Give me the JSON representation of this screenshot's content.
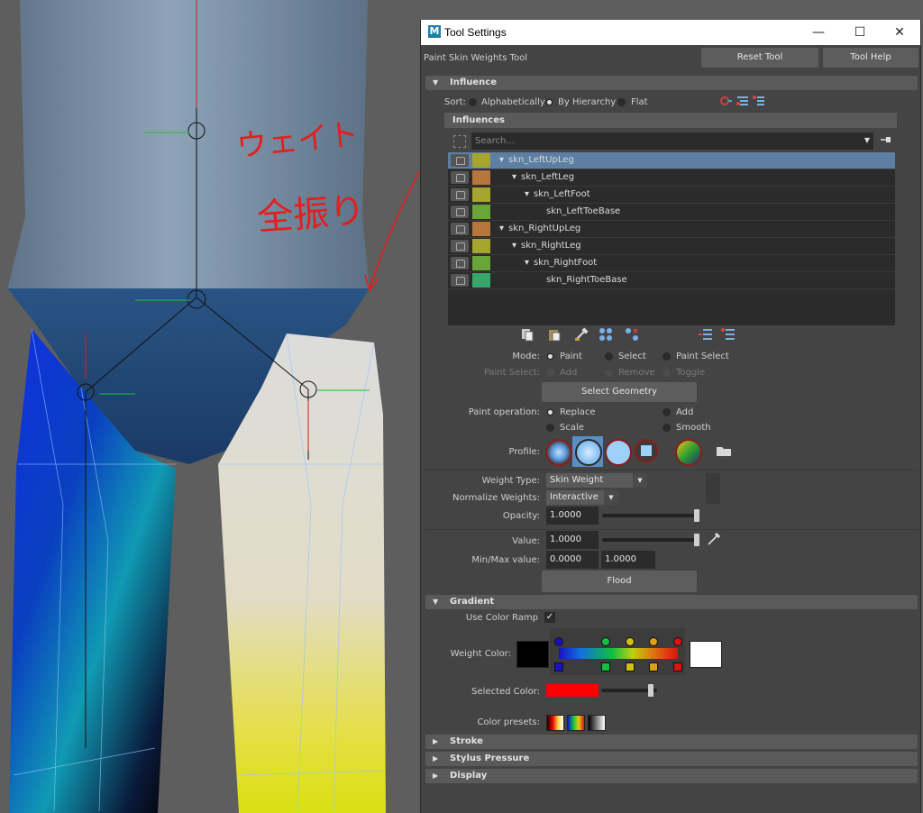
{
  "window": {
    "title": "Tool Settings",
    "logo_letter": "M",
    "minimize": "—",
    "maximize": "☐",
    "close": "✕"
  },
  "header": {
    "tool_name": "Paint Skin Weights Tool",
    "reset_label": "Reset Tool",
    "help_label": "Tool Help"
  },
  "influence": {
    "title": "Influence",
    "sort_label": "Sort:",
    "sort_options": [
      "Alphabetically",
      "By Hierarchy",
      "Flat"
    ],
    "sort_selected": "By Hierarchy",
    "influences_header": "Influences",
    "search_placeholder": "Search...",
    "items": [
      {
        "name": "skn_LeftUpLeg",
        "color": "#a5a530",
        "selected": true,
        "expander": "▾"
      },
      {
        "name": "skn_LeftLeg",
        "color": "#b8763e",
        "selected": false,
        "expander": "▾"
      },
      {
        "name": "skn_LeftFoot",
        "color": "#a5a530",
        "selected": false,
        "expander": "▾"
      },
      {
        "name": "skn_LeftToeBase",
        "color": "#6aa53a",
        "selected": false,
        "expander": ""
      },
      {
        "name": "skn_RightUpLeg",
        "color": "#b8763e",
        "selected": false,
        "expander": "▾"
      },
      {
        "name": "skn_RightLeg",
        "color": "#a5a530",
        "selected": false,
        "expander": "▾"
      },
      {
        "name": "skn_RightFoot",
        "color": "#6aa53a",
        "selected": false,
        "expander": "▾"
      },
      {
        "name": "skn_RightToeBase",
        "color": "#3aa56a",
        "selected": false,
        "expander": ""
      }
    ]
  },
  "mode": {
    "label": "Mode:",
    "options": [
      "Paint",
      "Select",
      "Paint Select"
    ],
    "selected": "Paint",
    "paint_select_label": "Paint Select:",
    "paint_select_options": [
      "Add",
      "Remove",
      "Toggle"
    ],
    "select_geometry_label": "Select Geometry"
  },
  "paint_operation": {
    "label": "Paint operation:",
    "options": [
      "Replace",
      "Add",
      "Scale",
      "Smooth"
    ],
    "selected": "Replace"
  },
  "profile": {
    "label": "Profile:"
  },
  "weights": {
    "weight_type_label": "Weight Type:",
    "weight_type_value": "Skin Weight",
    "normalize_label": "Normalize Weights:",
    "normalize_value": "Interactive",
    "opacity_label": "Opacity:",
    "opacity_value": "1.0000",
    "opacity_fraction": 1.0,
    "value_label": "Value:",
    "value_value": "1.0000",
    "value_fraction": 1.0,
    "minmax_label": "Min/Max value:",
    "min_value": "0.0000",
    "max_value": "1.0000",
    "flood_label": "Flood"
  },
  "gradient": {
    "title": "Gradient",
    "use_color_ramp_label": "Use Color Ramp",
    "use_color_ramp_checked": "✓",
    "weight_color_label": "Weight Color:",
    "weight_color_low": "#000000",
    "weight_color_high": "#ffffff",
    "selected_color_label": "Selected Color:",
    "selected_color": "#ff0000",
    "selected_color_fraction": 0.92,
    "color_presets_label": "Color presets:"
  },
  "collapsed_sections": [
    "Stroke",
    "Stylus Pressure",
    "Display"
  ],
  "annotation": {
    "text_line1": "ウェイト",
    "text_line2": "全振り",
    "color": "#e02020"
  }
}
